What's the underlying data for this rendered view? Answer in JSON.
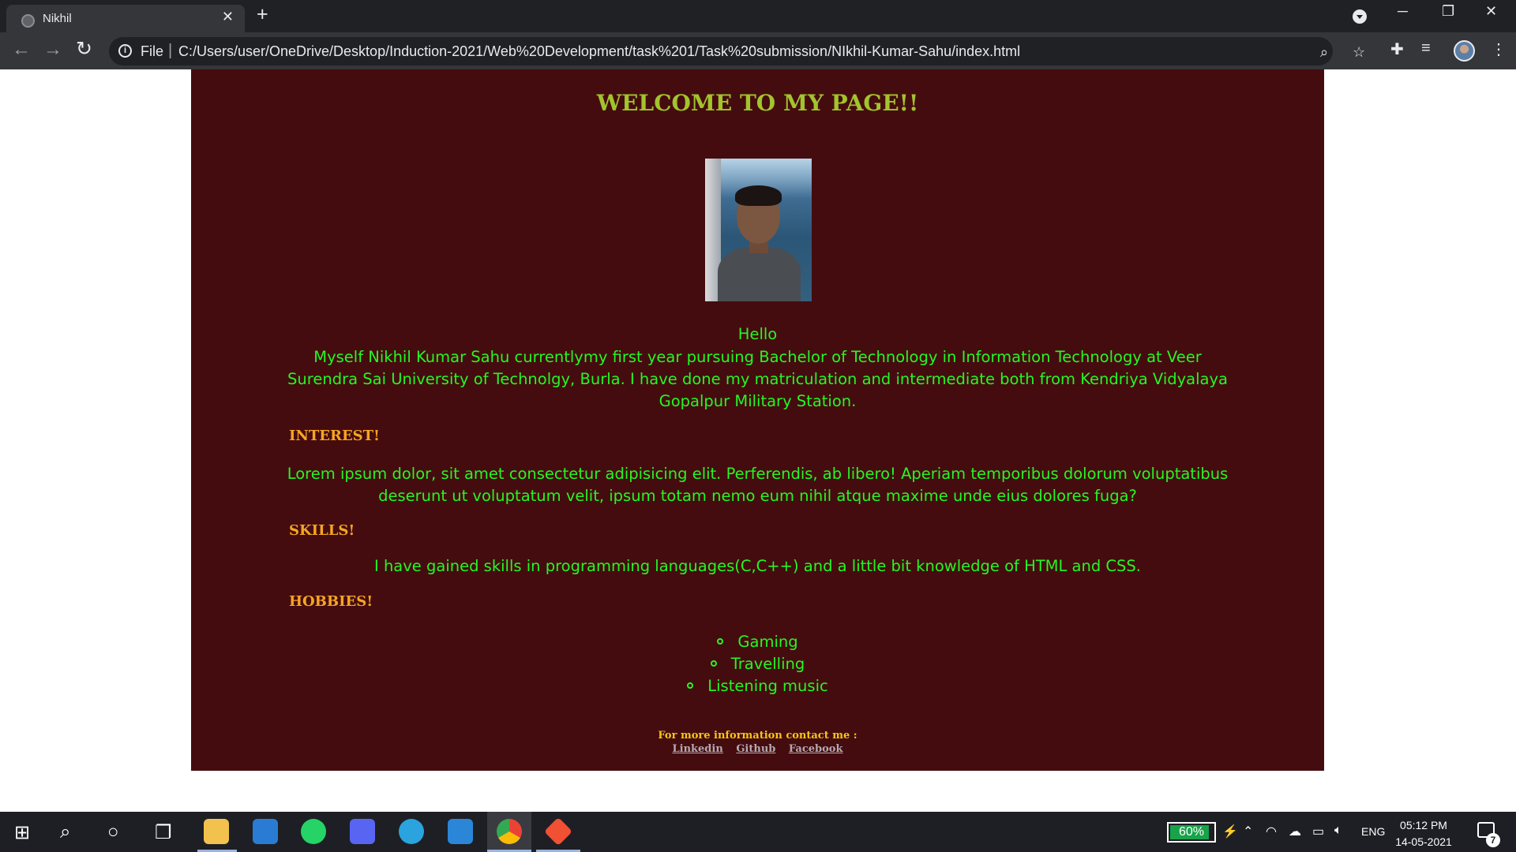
{
  "browser": {
    "tab_title": "Nikhil",
    "new_tab_symbol": "+",
    "scheme_label": "File",
    "address": "C:/Users/user/OneDrive/Desktop/Induction-2021/Web%20Development/task%201/Task%20submission/NIkhil-Kumar-Sahu/index.html",
    "icons": [
      "back-arrow-icon",
      "forward-arrow-icon",
      "reload-icon",
      "info-icon",
      "zoom-icon",
      "star-icon",
      "extensions-icon",
      "media-queue-icon",
      "profile-avatar",
      "more-menu-icon"
    ]
  },
  "page": {
    "welcome": "WELCOME TO MY PAGE!!",
    "hello": "Hello",
    "bio": "Myself Nikhil Kumar Sahu currentlymy first year pursuing Bachelor of Technology in Information Technology at Veer Surendra Sai University of Technolgy,  Burla. I have done my matriculation and intermediate both from Kendriya Vidyalaya Gopalpur Military Station.",
    "interest_heading": "INTEREST!",
    "interest_text": "Lorem ipsum dolor, sit amet consectetur adipisicing elit. Perferendis, ab libero! Aperiam temporibus dolorum voluptatibus deserunt ut voluptatum velit, ipsum totam nemo eum nihil atque maxime unde eius dolores fuga?",
    "skills_heading": "SKILLS!",
    "skills_text": "I have gained skills in programming languages(C,C++) and a little bit knowledge of HTML and CSS.",
    "hobbies_heading": "HOBBIES!",
    "hobbies": [
      "Gaming",
      "Travelling",
      "Listening music"
    ],
    "contact_label": "For more information contact me :",
    "links": [
      "Linkedin",
      "Github",
      "Facebook"
    ],
    "colors": {
      "background": "#450c0f",
      "title": "#a2c42c",
      "body_text": "#24f724",
      "headings": "#f5a623"
    }
  },
  "taskbar": {
    "battery_percent": "60%",
    "language": "ENG",
    "time": "05:12 PM",
    "date": "14-05-2021",
    "notification_count": "7",
    "pinned_apps": [
      "file-explorer",
      "mail",
      "whatsapp",
      "discord",
      "telegram",
      "vs-code",
      "chrome",
      "git"
    ]
  }
}
